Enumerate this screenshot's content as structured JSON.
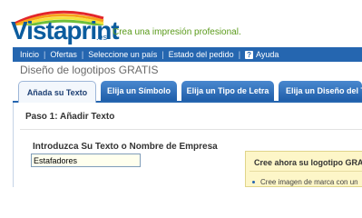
{
  "brand": {
    "logo_text": "Vistaprint",
    "tld": ".es",
    "tagline": "Crea una impresión profesional."
  },
  "nav": {
    "items": [
      "Inicio",
      "Ofertas",
      "Seleccione un país",
      "Estado del pedido"
    ],
    "help_label": "Ayuda",
    "separator": "|"
  },
  "page": {
    "title": "Diseño de logotipos GRATIS"
  },
  "tabs": [
    {
      "label": "Añada su Texto",
      "active": true
    },
    {
      "label": "Elija un Símbolo",
      "active": false
    },
    {
      "label": "Elija un Tipo de Letra",
      "active": false
    },
    {
      "label": "Elija un Diseño del Tex",
      "active": false
    }
  ],
  "step": {
    "title": "Paso 1: Añadir Texto",
    "field_label": "Introduzca Su Texto o Nombre de Empresa",
    "field_value": "Estafadores"
  },
  "promo": {
    "title": "Cree ahora su logotipo GRATIS",
    "bullet": "Cree imagen de marca con un"
  },
  "colors": {
    "brand_blue": "#2566b0",
    "tagline_green": "#5a9a1a",
    "promo_bg": "#fdf6c8"
  }
}
